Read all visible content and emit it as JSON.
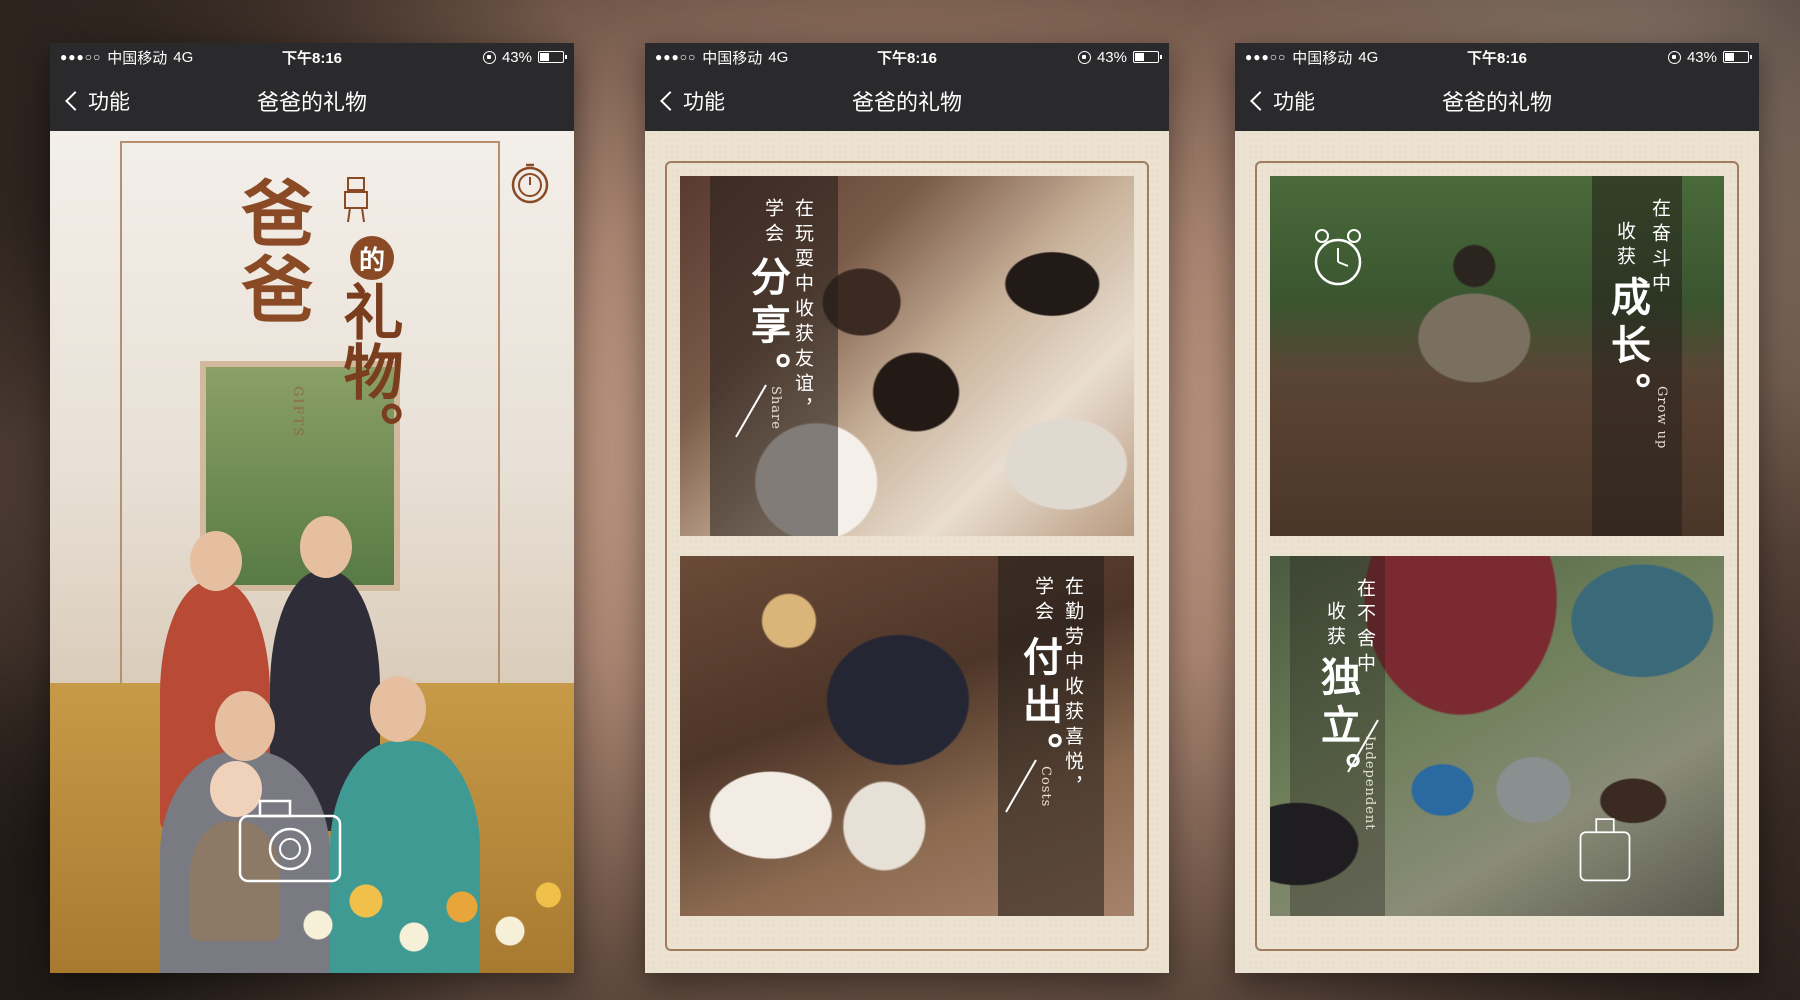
{
  "status_bar": {
    "signal": "●●●○○",
    "carrier": "中国移动",
    "network": "4G",
    "time": "下午8:16",
    "battery": "43%",
    "battery_level": 0.43
  },
  "nav": {
    "back_label": "功能",
    "title": "爸爸的礼物"
  },
  "poster": {
    "title_line1": "爸爸",
    "title_de": "的",
    "title_line2": "礼物。",
    "subtitle_en": "GIFTS"
  },
  "cards": {
    "share": {
      "line1": "在玩耍中收获友谊，",
      "line2": "学会",
      "big": "分享。",
      "en": "Share"
    },
    "costs": {
      "line1": "在勤劳中收获喜悦，",
      "line2": "学会",
      "big": "付出。",
      "en": "Costs"
    },
    "grow": {
      "line1": "在奋斗中",
      "line2": "收获",
      "big": "成长。",
      "en": "Grow up"
    },
    "independent": {
      "line1": "在不舍中",
      "line2": "收获",
      "big": "独立。",
      "en": "Independent"
    }
  },
  "colors": {
    "bar": "#2a2a2c",
    "title_brown": "#8a4a26",
    "paper": "#ece2d1"
  }
}
